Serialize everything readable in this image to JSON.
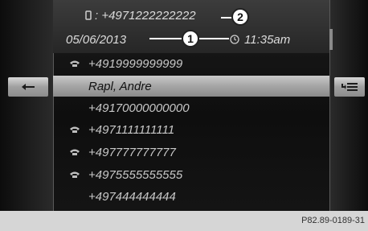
{
  "header": {
    "number_line": ": +4971222222222",
    "date": "05/06/2013",
    "time": "11:35am"
  },
  "callouts": [
    "1",
    "2"
  ],
  "entries": [
    {
      "text": "+4919999999999",
      "icon": "phone-icon"
    },
    {
      "text": "Rapl, Andre",
      "icon": "",
      "selected": true
    },
    {
      "text": "+49170000000000",
      "icon": ""
    },
    {
      "text": "+4971111111111",
      "icon": "phone-icon"
    },
    {
      "text": "+497777777777",
      "icon": "phone-icon"
    },
    {
      "text": "+4975555555555",
      "icon": "phone-icon"
    },
    {
      "text": "+497444444444",
      "icon": ""
    }
  ],
  "figure_code": "P82.89-0189-31"
}
